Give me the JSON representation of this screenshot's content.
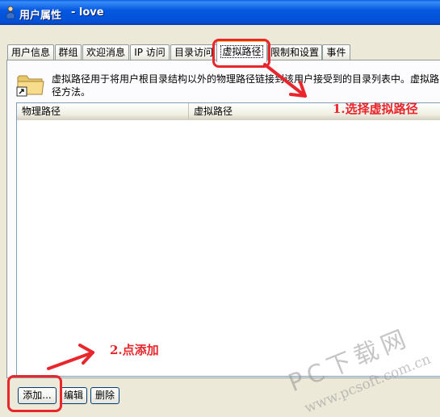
{
  "window": {
    "title": "用户属性",
    "user": "- love"
  },
  "tabs": [
    {
      "label": "用户信息"
    },
    {
      "label": "群组"
    },
    {
      "label": "欢迎消息"
    },
    {
      "label": "IP 访问"
    },
    {
      "label": "目录访问"
    },
    {
      "label": "虚拟路径"
    },
    {
      "label": "限制和设置"
    },
    {
      "label": "事件"
    }
  ],
  "active_tab": "虚拟路径",
  "panel": {
    "description": "虚拟路径用于将用户根目录结构以外的物理路径链接到该用户接受到的目录列表中。虚拟路径方法。",
    "columns": [
      "物理路径",
      "虚拟路径"
    ]
  },
  "buttons": {
    "add": "添加...",
    "edit": "编辑",
    "delete": "删除"
  },
  "annotations": {
    "step1": "1.选择虚拟路径",
    "step2": "2.点添加",
    "color": "#E8262C"
  },
  "watermark": {
    "brand": "PC下载网",
    "site": "www.pcsoft.com.cn"
  }
}
